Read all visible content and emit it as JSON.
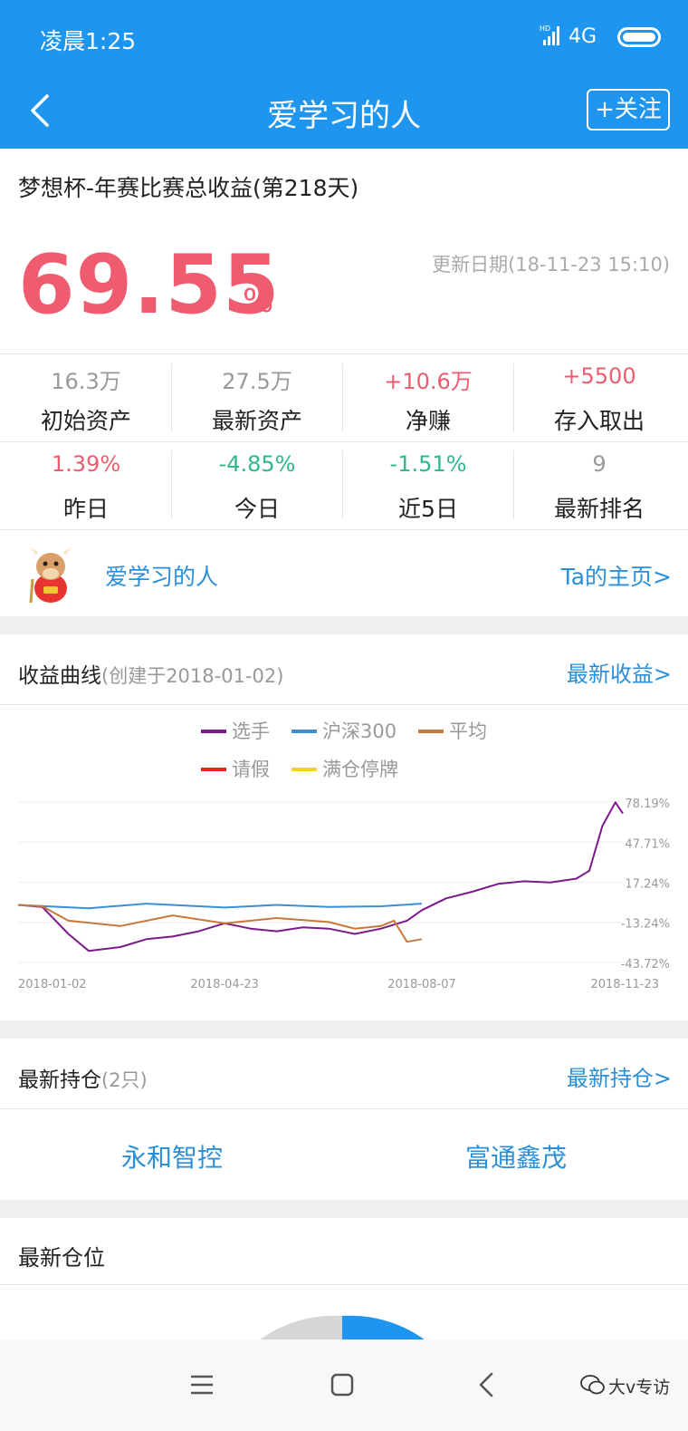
{
  "status_bar": {
    "time": "凌晨1:25",
    "hd_label": "HD",
    "network": "4G"
  },
  "header": {
    "title": "爱学习的人",
    "follow_label": "+关注"
  },
  "competition": {
    "title": "梦想杯-年赛比赛总收益(第218天)",
    "total_return": "69.55",
    "percent_sign": "%",
    "update_text": "更新日期(18-11-23 15:10)"
  },
  "stats": [
    {
      "value": "16.3万",
      "label": "初始资产",
      "color": "#999999"
    },
    {
      "value": "27.5万",
      "label": "最新资产",
      "color": "#999999"
    },
    {
      "value": "+10.6万",
      "label": "净赚",
      "color": "#ef5b6f"
    },
    {
      "value": "+5500",
      "label": "存入取出",
      "color": "#ef5b6f"
    },
    {
      "value": "1.39%",
      "label": "昨日",
      "color": "#ef5b6f"
    },
    {
      "value": "-4.85%",
      "label": "今日",
      "color": "#2fb88a"
    },
    {
      "value": "-1.51%",
      "label": "近5日",
      "color": "#2fb88a"
    },
    {
      "value": "9",
      "label": "最新排名",
      "color": "#999999"
    }
  ],
  "user": {
    "name": "爱学习的人",
    "homepage_link": "Ta的主页>"
  },
  "curve_section": {
    "title": "收益曲线",
    "subtitle": "(创建于2018-01-02)",
    "link": "最新收益>"
  },
  "chart_data": {
    "type": "line",
    "legend": [
      {
        "name": "选手",
        "color": "#7b1a8a"
      },
      {
        "name": "沪深300",
        "color": "#3a8fd6"
      },
      {
        "name": "平均",
        "color": "#c8783a"
      },
      {
        "name": "请假",
        "color": "#e8251f"
      },
      {
        "name": "满仓停牌",
        "color": "#f4d51c"
      }
    ],
    "y_ticks": [
      "78.19%",
      "47.71%",
      "17.24%",
      "-13.24%",
      "-43.72%"
    ],
    "ylim": [
      -43.72,
      78.19
    ],
    "x_ticks": [
      "2018-01-02",
      "2018-04-23",
      "2018-08-07",
      "2018-11-23"
    ],
    "series": [
      {
        "name": "选手",
        "color": "#7b1a8a",
        "x": [
          "2018-01-02",
          "2018-01-15",
          "2018-01-29",
          "2018-02-09",
          "2018-02-26",
          "2018-03-12",
          "2018-03-26",
          "2018-04-09",
          "2018-04-23",
          "2018-05-07",
          "2018-05-21",
          "2018-06-04",
          "2018-06-18",
          "2018-07-02",
          "2018-07-16",
          "2018-07-30",
          "2018-08-07",
          "2018-08-20",
          "2018-09-03",
          "2018-09-17",
          "2018-10-01",
          "2018-10-15",
          "2018-10-29",
          "2018-11-05",
          "2018-11-12",
          "2018-11-19",
          "2018-11-23"
        ],
        "y": [
          0.0,
          -1.5,
          -22.0,
          -35.0,
          -32.0,
          -26.0,
          -24.0,
          -20.0,
          -14.0,
          -18.0,
          -20.0,
          -17.0,
          -18.0,
          -22.0,
          -18.0,
          -12.0,
          -4.0,
          5.0,
          10.0,
          16.0,
          18.0,
          17.0,
          20.0,
          26.0,
          60.0,
          78.0,
          69.5
        ]
      },
      {
        "name": "沪深300",
        "color": "#3a8fd6",
        "x": [
          "2018-01-02",
          "2018-02-09",
          "2018-03-12",
          "2018-04-23",
          "2018-05-21",
          "2018-06-18",
          "2018-07-16",
          "2018-08-07"
        ],
        "y": [
          0.0,
          -2.5,
          1.0,
          -2.0,
          0.0,
          -1.5,
          -1.0,
          1.0
        ]
      },
      {
        "name": "平均",
        "color": "#c8783a",
        "x": [
          "2018-01-02",
          "2018-01-15",
          "2018-01-29",
          "2018-02-26",
          "2018-03-26",
          "2018-04-23",
          "2018-05-21",
          "2018-06-18",
          "2018-07-02",
          "2018-07-16",
          "2018-07-23",
          "2018-07-30",
          "2018-08-07"
        ],
        "y": [
          0.0,
          -1.0,
          -12.0,
          -16.0,
          -8.0,
          -14.0,
          -10.0,
          -13.0,
          -18.0,
          -16.0,
          -12.0,
          -28.0,
          -26.0
        ]
      }
    ]
  },
  "holdings_section": {
    "title": "最新持仓",
    "count": "(2只)",
    "link": "最新持仓>",
    "stocks": [
      "永和智控",
      "富通鑫茂"
    ]
  },
  "position_section": {
    "title": "最新仓位"
  },
  "watermark": {
    "text": "大v专访"
  },
  "colors": {
    "brand_blue": "#1e96f0",
    "link_blue": "#2a8fd8",
    "gain_red": "#ef5b6f",
    "loss_green": "#2fb88a"
  }
}
